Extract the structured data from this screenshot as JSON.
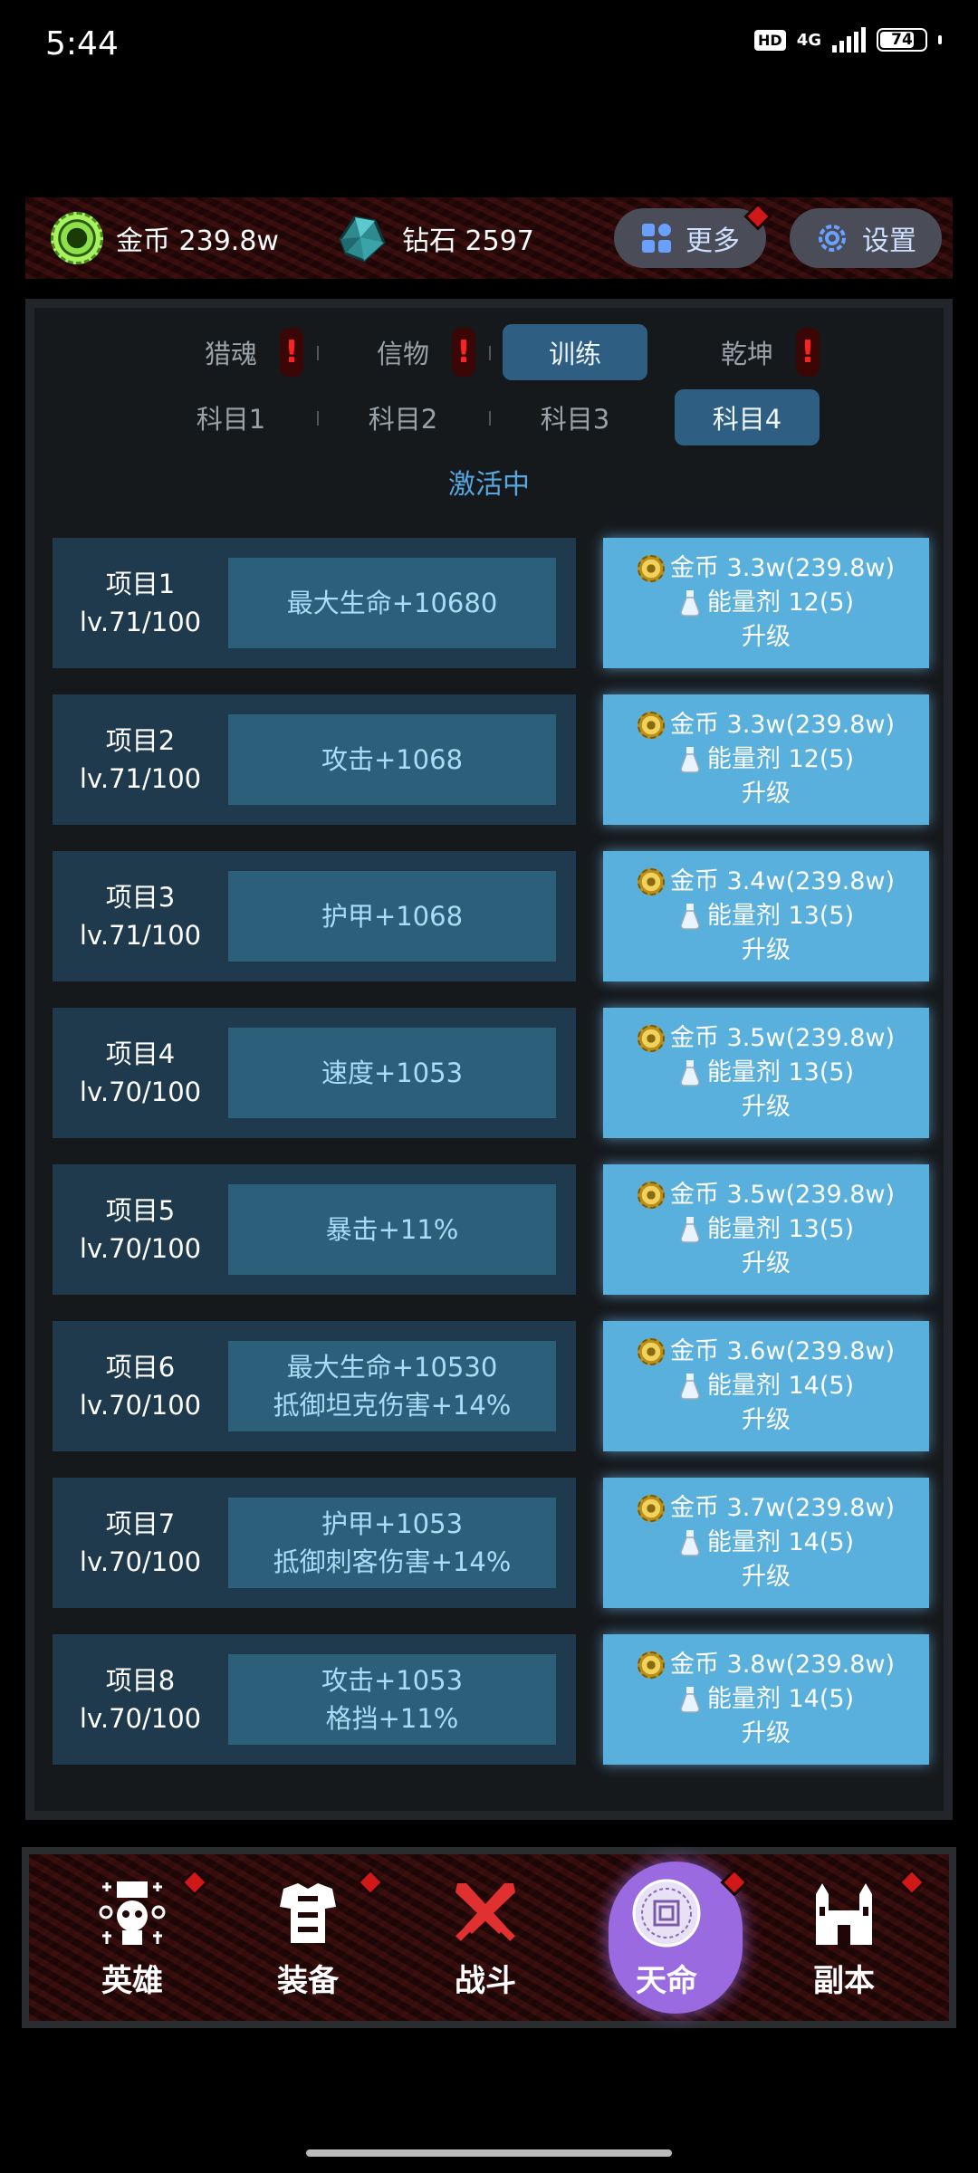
{
  "status_bar": {
    "time": "5:44",
    "hd": "HD",
    "network": "4G",
    "battery": "74"
  },
  "resources": {
    "gold_label": "金币 239.8w",
    "diamond_label": "钻石 2597",
    "more_label": "更多",
    "settings_label": "设置"
  },
  "tabs_top": [
    {
      "label": "猎魂",
      "alert": true
    },
    {
      "label": "信物",
      "alert": true
    },
    {
      "label": "训练",
      "active": true
    },
    {
      "label": "乾坤",
      "alert": true
    }
  ],
  "tabs_sub": [
    {
      "label": "科目1"
    },
    {
      "label": "科目2"
    },
    {
      "label": "科目3"
    },
    {
      "label": "科目4",
      "active": true
    }
  ],
  "status_text": "激活中",
  "upgrade_label": "升级",
  "items": [
    {
      "name": "项目1",
      "level": "lv.71/100",
      "effect1": "最大生命+10680",
      "effect2": "",
      "cost_gold": "金币 3.3w(239.8w)",
      "cost_energy": "能量剂 12(5)"
    },
    {
      "name": "项目2",
      "level": "lv.71/100",
      "effect1": "攻击+1068",
      "effect2": "",
      "cost_gold": "金币 3.3w(239.8w)",
      "cost_energy": "能量剂 12(5)"
    },
    {
      "name": "项目3",
      "level": "lv.71/100",
      "effect1": "护甲+1068",
      "effect2": "",
      "cost_gold": "金币 3.4w(239.8w)",
      "cost_energy": "能量剂 13(5)"
    },
    {
      "name": "项目4",
      "level": "lv.70/100",
      "effect1": "速度+1053",
      "effect2": "",
      "cost_gold": "金币 3.5w(239.8w)",
      "cost_energy": "能量剂 13(5)"
    },
    {
      "name": "项目5",
      "level": "lv.70/100",
      "effect1": "暴击+11%",
      "effect2": "",
      "cost_gold": "金币 3.5w(239.8w)",
      "cost_energy": "能量剂 13(5)"
    },
    {
      "name": "项目6",
      "level": "lv.70/100",
      "effect1": "最大生命+10530",
      "effect2": "抵御坦克伤害+14%",
      "cost_gold": "金币 3.6w(239.8w)",
      "cost_energy": "能量剂 14(5)"
    },
    {
      "name": "项目7",
      "level": "lv.70/100",
      "effect1": "护甲+1053",
      "effect2": "抵御刺客伤害+14%",
      "cost_gold": "金币 3.7w(239.8w)",
      "cost_energy": "能量剂 14(5)"
    },
    {
      "name": "项目8",
      "level": "lv.70/100",
      "effect1": "攻击+1053",
      "effect2": "格挡+11%",
      "cost_gold": "金币 3.8w(239.8w)",
      "cost_energy": "能量剂 14(5)"
    }
  ],
  "nav": [
    {
      "label": "英雄",
      "icon": "skull-totem-icon"
    },
    {
      "label": "装备",
      "icon": "armor-icon"
    },
    {
      "label": "战斗",
      "icon": "crossed-swords-icon"
    },
    {
      "label": "天命",
      "icon": "destiny-seal-icon",
      "active": true
    },
    {
      "label": "副本",
      "icon": "castle-icon"
    }
  ],
  "colors": {
    "accent_blue": "#59b0dc",
    "tab_active": "#2e5f82",
    "nav_active": "#9a6ae0",
    "alert_red": "#ff2020"
  }
}
